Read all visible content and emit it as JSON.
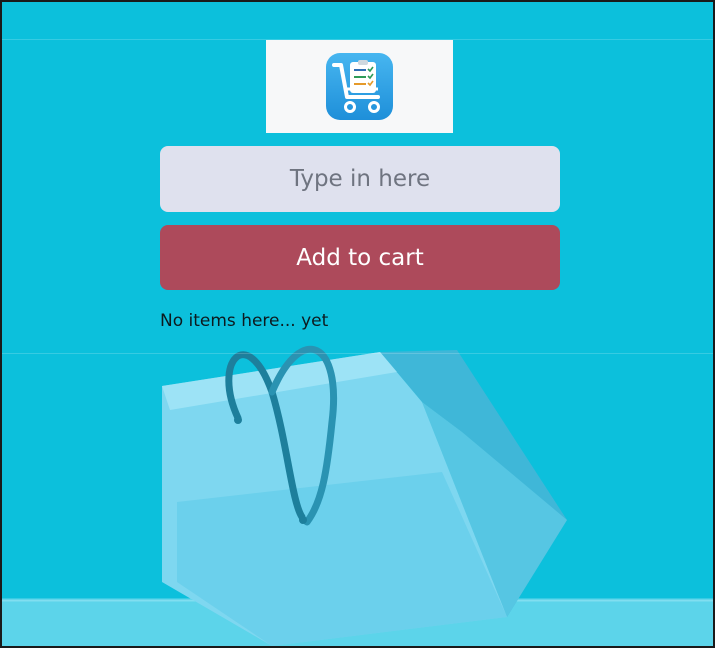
{
  "app": {
    "logo_icon": "shopping-list-cart-icon",
    "input": {
      "placeholder": "Type in here",
      "value": ""
    },
    "add_button_label": "Add to cart",
    "empty_message": "No items here... yet"
  },
  "background": {
    "illustration": "shopping-bag",
    "colors": {
      "page": "#0cc0dc",
      "button": "#ad4a5b",
      "input": "#dfe1ee",
      "logo_bg": "#f7f8f9",
      "icon_blue": "#2fa3e6"
    }
  }
}
